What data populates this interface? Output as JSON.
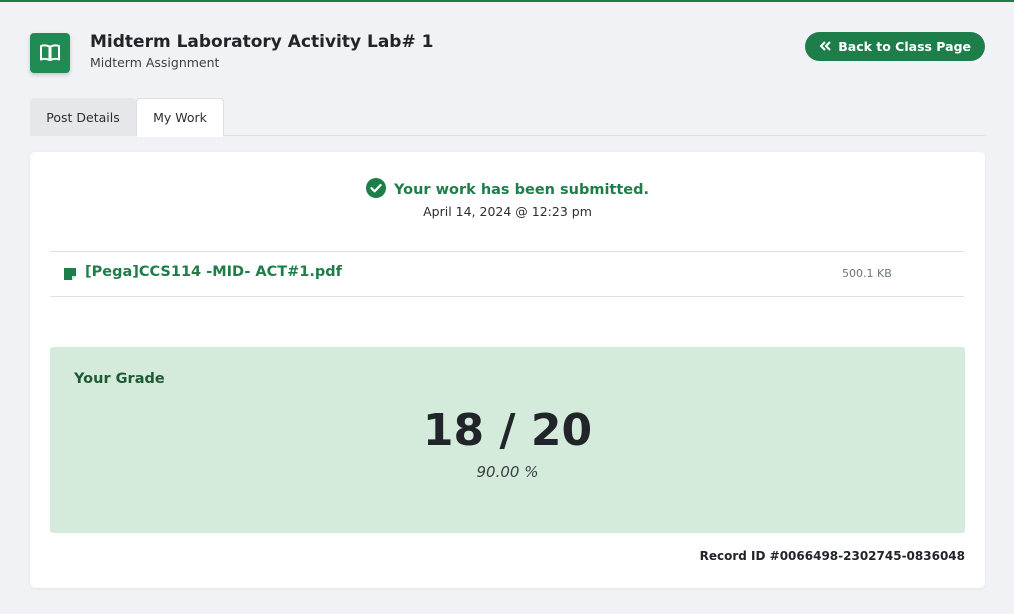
{
  "header": {
    "title": "Midterm Laboratory Activity Lab# 1",
    "subtitle": "Midterm Assignment",
    "icon": "book-open-icon",
    "back_label": "Back to Class Page",
    "back_icon": "double-chevron-left-icon"
  },
  "tabs": [
    {
      "label": "Post Details",
      "active": false
    },
    {
      "label": "My Work",
      "active": true
    }
  ],
  "submission": {
    "status": "Your work has been submitted.",
    "status_icon": "check-circle-icon",
    "date": "April 14, 2024 @ 12:23 pm"
  },
  "file": {
    "name": "[Pega]CCS114 -MID- ACT#1.pdf",
    "size": "500.1 KB",
    "icon": "file-icon"
  },
  "grade": {
    "label": "Your Grade",
    "score": "18 / 20",
    "percent": "90.00 %"
  },
  "record": "Record ID #0066498-2302745-0836048",
  "colors": {
    "accent": "#1e7e4a",
    "grade_bg": "#d4ebdb",
    "page_bg": "#f1f2f6"
  }
}
